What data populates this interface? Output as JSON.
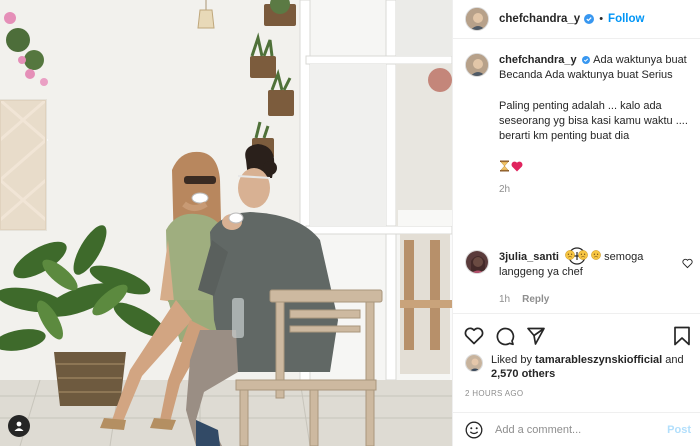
{
  "post": {
    "author": "chefchandra_y",
    "follow_label": "Follow",
    "separator": "•",
    "caption_lines_1": [
      "Ada waktunya buat",
      "Becanda Ada waktunya buat Serius"
    ],
    "caption_lines_2": [
      "Paling penting adalah ... kalo ada",
      "seseorang yg bisa kasi kamu waktu ....",
      "berarti km penting buat dia"
    ],
    "caption_emojis": [
      "hourglass-emoji",
      "heart-emoji"
    ],
    "caption_age": "2h"
  },
  "comment": {
    "author": "3julia_santi",
    "emojis": [
      "disappointed-face-emoji",
      "disappointed-face-emoji",
      "disappointed-face-emoji"
    ],
    "text": "semoga langgeng ya chef",
    "age": "1h",
    "reply_label": "Reply"
  },
  "likes": {
    "prefix": "Liked by",
    "user": "tamarableszynskiofficial",
    "conjunction": "and",
    "others": "2,570 others"
  },
  "posted_time": "2 HOURS AGO",
  "add_comment": {
    "placeholder": "Add a comment...",
    "post_label": "Post"
  },
  "colors": {
    "accent": "#0095f6",
    "post_disabled": "#b2dffc",
    "text": "#262626",
    "muted": "#8e8e8e",
    "verified": "#3897f0"
  },
  "icons": {
    "like": "heart-outline-icon",
    "comment": "comment-bubble-icon",
    "share": "paper-plane-icon",
    "save": "bookmark-icon",
    "load_more": "plus-circle-icon",
    "emoji": "smiley-icon",
    "tagged_users": "user-icon"
  }
}
